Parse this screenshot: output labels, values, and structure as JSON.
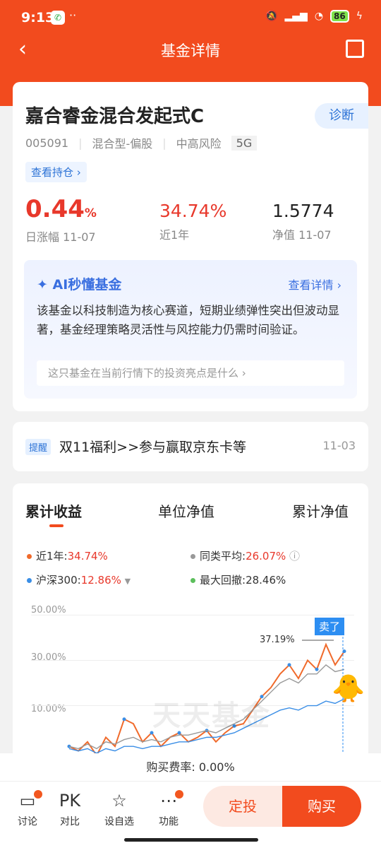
{
  "status": {
    "time": "9:13",
    "battery": "86",
    "dots": "··"
  },
  "nav": {
    "title": "基金详情"
  },
  "fund": {
    "name": "嘉合睿金混合发起式C",
    "diag_label": "诊断",
    "code": "005091",
    "type": "混合型-偏股",
    "risk": "中高风险",
    "level": "5G",
    "holdings_label": "查看持仓 ›",
    "daily_change": "0.44",
    "daily_change_unit": "%",
    "daily_label": "日涨幅 11-07",
    "year_return": "34.74%",
    "year_label": "近1年",
    "nav_value": "1.5774",
    "nav_label": "净值 11-07"
  },
  "ai": {
    "title": "AI秒懂基金",
    "more": "查看详情 ›",
    "text": "该基金以科技制造为核心赛道，短期业绩弹性突出但波动显著，基金经理策略灵活性与风控能力仍需时间验证。",
    "question": "这只基金在当前行情下的投资亮点是什么 ›"
  },
  "notice": {
    "tag": "提醒",
    "text": "双11福利>>参与赢取京东卡等",
    "date": "11-03"
  },
  "chart_tabs": [
    "累计收益",
    "单位净值",
    "累计净值"
  ],
  "legend": {
    "fund_label": "近1年:",
    "fund_value": "34.74%",
    "peer_label": "同类平均:",
    "peer_value": "26.07%",
    "index_label": "沪深300:",
    "index_value": "12.86%",
    "drawdown_label": "最大回撤:",
    "drawdown_value": "28.46%"
  },
  "chart_data": {
    "type": "line",
    "yticks": [
      "50.00%",
      "30.00%",
      "10.00%"
    ],
    "peak_label": "37.19%",
    "sell_label": "卖了",
    "watermark": "天天基金",
    "series": [
      {
        "name": "近1年",
        "color": "#f06a2b",
        "values": [
          -8,
          -10,
          -6,
          -12,
          -4,
          -8,
          4,
          2,
          -6,
          -2,
          -8,
          -4,
          -2,
          -6,
          -4,
          -1,
          -6,
          -2,
          1,
          2,
          8,
          14,
          18,
          24,
          28,
          22,
          30,
          26,
          37,
          28,
          34
        ]
      },
      {
        "name": "同类平均",
        "color": "#999999",
        "values": [
          -8,
          -9,
          -7,
          -9,
          -6,
          -7,
          -5,
          -4,
          -6,
          -5,
          -6,
          -4,
          -3,
          -3,
          -2,
          -1,
          -2,
          0,
          2,
          4,
          8,
          12,
          16,
          20,
          22,
          20,
          24,
          24,
          28,
          25,
          26
        ]
      },
      {
        "name": "沪深300",
        "color": "#3a8ee6",
        "values": [
          -9,
          -10,
          -9,
          -11,
          -9,
          -10,
          -8,
          -8,
          -9,
          -8,
          -8,
          -7,
          -6,
          -6,
          -5,
          -4,
          -4,
          -3,
          -2,
          0,
          2,
          4,
          6,
          8,
          9,
          8,
          10,
          10,
          12,
          11,
          13
        ]
      }
    ],
    "ylim": [
      -12,
      52
    ]
  },
  "fee": "购买费率: 0.00%",
  "bottom": {
    "discuss": "讨论",
    "compare_icon": "PK",
    "compare": "对比",
    "watch": "设自选",
    "func": "功能",
    "fixed": "定投",
    "buy": "购买"
  }
}
